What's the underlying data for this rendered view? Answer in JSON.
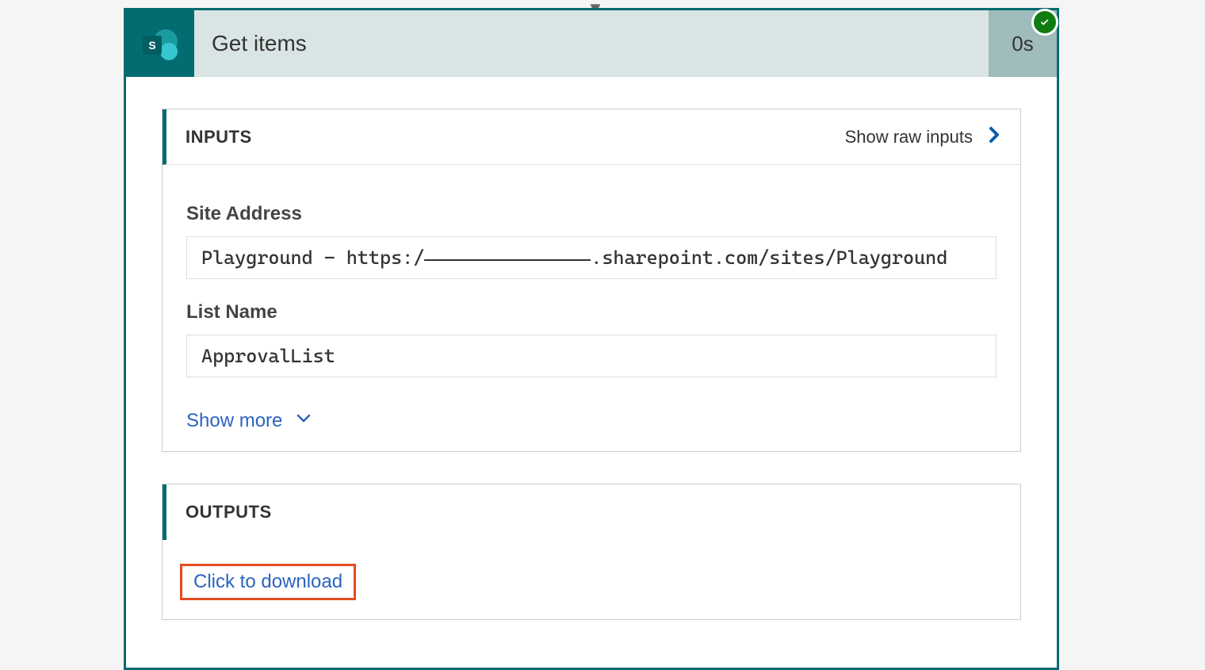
{
  "connector_icon": "sharepoint",
  "header": {
    "title": "Get items",
    "duration": "0s",
    "status": "success"
  },
  "inputs": {
    "section_label": "INPUTS",
    "raw_link": "Show raw inputs",
    "fields": {
      "site_address": {
        "label": "Site Address",
        "prefix": "Playground - https:/",
        "suffix": ".sharepoint.com/sites/Playground"
      },
      "list_name": {
        "label": "List Name",
        "value": "ApprovalList"
      }
    },
    "show_more": "Show more"
  },
  "outputs": {
    "section_label": "OUTPUTS",
    "download_link": "Click to download"
  }
}
